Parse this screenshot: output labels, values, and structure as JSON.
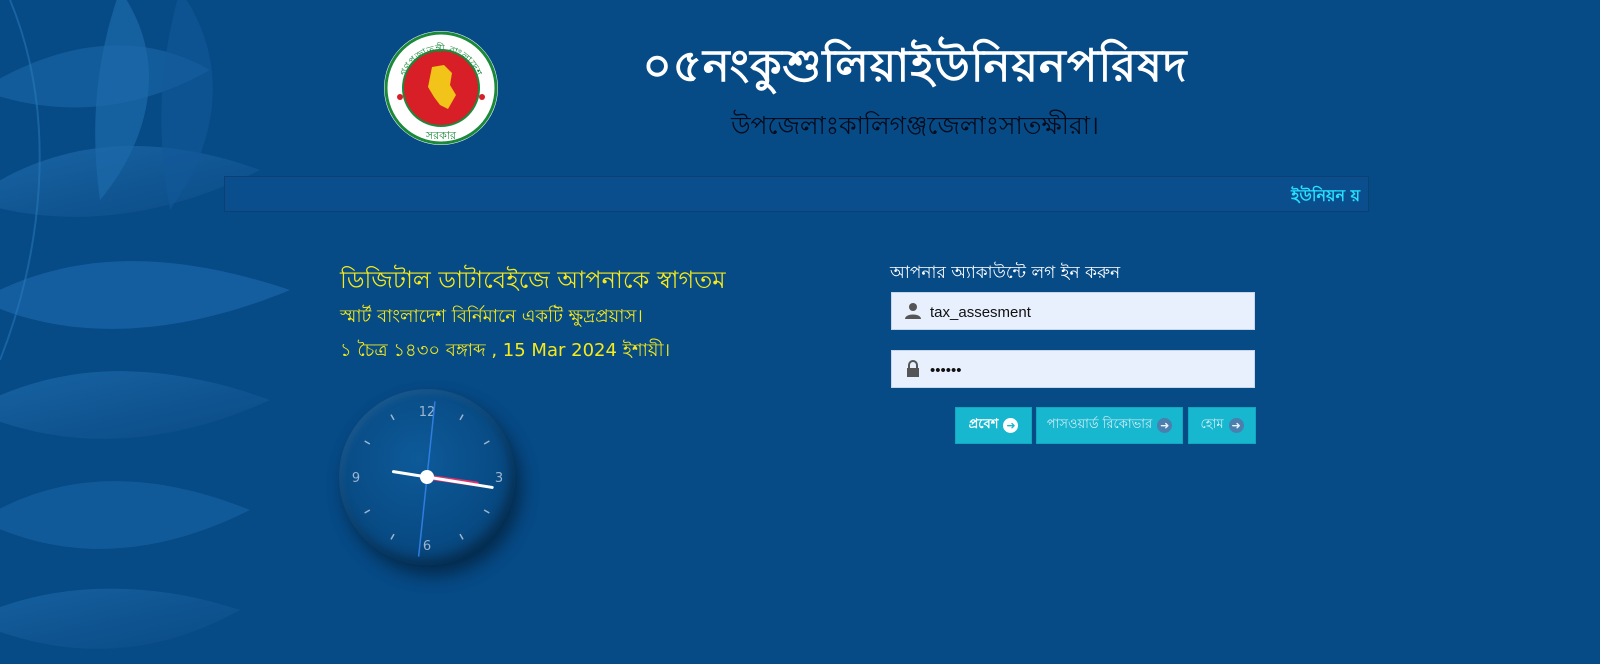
{
  "header": {
    "title": "০৫নংকুশুলিয়াইউনিয়নপরিষদ",
    "subtitle": "উপজেলাঃকালিগঞ্জজেলাঃসাতক্ষীরা।",
    "emblem": {
      "top_text": "গণপ্রজাতন্ত্রী বাংলাদেশ",
      "bottom_text": "সরকার"
    }
  },
  "marquee": {
    "text": "ইউনিয়ন য়"
  },
  "welcome": {
    "heading": "ডিজিটাল ডাটাবেইজে আপনাকে স্বাগতম",
    "slogan": "স্মার্ট বাংলাদেশ বির্নিমানে একটি ক্ষুদ্রপ্রয়াস।",
    "date_line": "১ চৈত্র ১৪৩০ বঙ্গাব্দ , 15 Mar 2024 ইশায়ী।"
  },
  "clock": {
    "numerals": {
      "twelve": "12",
      "three": "3",
      "six": "6",
      "nine": "9"
    },
    "time": {
      "hour": 3,
      "minute": 16,
      "second": 31
    }
  },
  "login": {
    "heading": "আপনার অ্যাকাউন্টে লগ ইন করুন",
    "username_value": "tax_assesment",
    "password_value": "••••••",
    "login_button": "প্রবেশ",
    "recover_button": "পাসওয়ার্ড রিকোভার",
    "home_button": "হোম"
  },
  "colors": {
    "background": "#064a86",
    "accent_yellow": "#f7ea1a",
    "button": "#17b7d0",
    "marquee_text": "#27e0ff"
  },
  "icons": {
    "user": "user-icon",
    "password": "lock-icon",
    "arrow": "arrow-circle-right-icon"
  }
}
